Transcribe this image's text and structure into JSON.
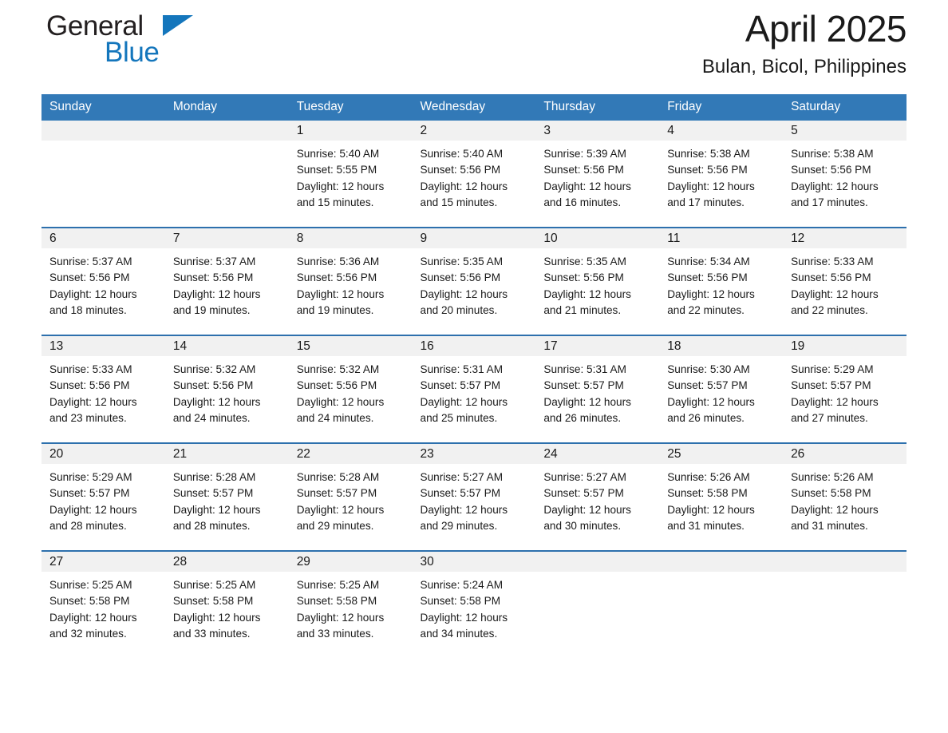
{
  "brand": {
    "line1": "General",
    "line2": "Blue",
    "triangle_icon": "brand-triangle-icon",
    "accent_color": "#1476bc"
  },
  "header": {
    "title": "April 2025",
    "subtitle": "Bulan, Bicol, Philippines"
  },
  "theme": {
    "header_bar_color": "#3279b7",
    "row_divider_color": "#2d70ad",
    "daynum_band_color": "#f1f1f1"
  },
  "weekday_headers": [
    "Sunday",
    "Monday",
    "Tuesday",
    "Wednesday",
    "Thursday",
    "Friday",
    "Saturday"
  ],
  "weeks": [
    [
      {
        "day": "",
        "sunrise": "",
        "sunset": "",
        "daylight_1": "",
        "daylight_2": ""
      },
      {
        "day": "",
        "sunrise": "",
        "sunset": "",
        "daylight_1": "",
        "daylight_2": ""
      },
      {
        "day": "1",
        "sunrise": "Sunrise: 5:40 AM",
        "sunset": "Sunset: 5:55 PM",
        "daylight_1": "Daylight: 12 hours",
        "daylight_2": "and 15 minutes."
      },
      {
        "day": "2",
        "sunrise": "Sunrise: 5:40 AM",
        "sunset": "Sunset: 5:56 PM",
        "daylight_1": "Daylight: 12 hours",
        "daylight_2": "and 15 minutes."
      },
      {
        "day": "3",
        "sunrise": "Sunrise: 5:39 AM",
        "sunset": "Sunset: 5:56 PM",
        "daylight_1": "Daylight: 12 hours",
        "daylight_2": "and 16 minutes."
      },
      {
        "day": "4",
        "sunrise": "Sunrise: 5:38 AM",
        "sunset": "Sunset: 5:56 PM",
        "daylight_1": "Daylight: 12 hours",
        "daylight_2": "and 17 minutes."
      },
      {
        "day": "5",
        "sunrise": "Sunrise: 5:38 AM",
        "sunset": "Sunset: 5:56 PM",
        "daylight_1": "Daylight: 12 hours",
        "daylight_2": "and 17 minutes."
      }
    ],
    [
      {
        "day": "6",
        "sunrise": "Sunrise: 5:37 AM",
        "sunset": "Sunset: 5:56 PM",
        "daylight_1": "Daylight: 12 hours",
        "daylight_2": "and 18 minutes."
      },
      {
        "day": "7",
        "sunrise": "Sunrise: 5:37 AM",
        "sunset": "Sunset: 5:56 PM",
        "daylight_1": "Daylight: 12 hours",
        "daylight_2": "and 19 minutes."
      },
      {
        "day": "8",
        "sunrise": "Sunrise: 5:36 AM",
        "sunset": "Sunset: 5:56 PM",
        "daylight_1": "Daylight: 12 hours",
        "daylight_2": "and 19 minutes."
      },
      {
        "day": "9",
        "sunrise": "Sunrise: 5:35 AM",
        "sunset": "Sunset: 5:56 PM",
        "daylight_1": "Daylight: 12 hours",
        "daylight_2": "and 20 minutes."
      },
      {
        "day": "10",
        "sunrise": "Sunrise: 5:35 AM",
        "sunset": "Sunset: 5:56 PM",
        "daylight_1": "Daylight: 12 hours",
        "daylight_2": "and 21 minutes."
      },
      {
        "day": "11",
        "sunrise": "Sunrise: 5:34 AM",
        "sunset": "Sunset: 5:56 PM",
        "daylight_1": "Daylight: 12 hours",
        "daylight_2": "and 22 minutes."
      },
      {
        "day": "12",
        "sunrise": "Sunrise: 5:33 AM",
        "sunset": "Sunset: 5:56 PM",
        "daylight_1": "Daylight: 12 hours",
        "daylight_2": "and 22 minutes."
      }
    ],
    [
      {
        "day": "13",
        "sunrise": "Sunrise: 5:33 AM",
        "sunset": "Sunset: 5:56 PM",
        "daylight_1": "Daylight: 12 hours",
        "daylight_2": "and 23 minutes."
      },
      {
        "day": "14",
        "sunrise": "Sunrise: 5:32 AM",
        "sunset": "Sunset: 5:56 PM",
        "daylight_1": "Daylight: 12 hours",
        "daylight_2": "and 24 minutes."
      },
      {
        "day": "15",
        "sunrise": "Sunrise: 5:32 AM",
        "sunset": "Sunset: 5:56 PM",
        "daylight_1": "Daylight: 12 hours",
        "daylight_2": "and 24 minutes."
      },
      {
        "day": "16",
        "sunrise": "Sunrise: 5:31 AM",
        "sunset": "Sunset: 5:57 PM",
        "daylight_1": "Daylight: 12 hours",
        "daylight_2": "and 25 minutes."
      },
      {
        "day": "17",
        "sunrise": "Sunrise: 5:31 AM",
        "sunset": "Sunset: 5:57 PM",
        "daylight_1": "Daylight: 12 hours",
        "daylight_2": "and 26 minutes."
      },
      {
        "day": "18",
        "sunrise": "Sunrise: 5:30 AM",
        "sunset": "Sunset: 5:57 PM",
        "daylight_1": "Daylight: 12 hours",
        "daylight_2": "and 26 minutes."
      },
      {
        "day": "19",
        "sunrise": "Sunrise: 5:29 AM",
        "sunset": "Sunset: 5:57 PM",
        "daylight_1": "Daylight: 12 hours",
        "daylight_2": "and 27 minutes."
      }
    ],
    [
      {
        "day": "20",
        "sunrise": "Sunrise: 5:29 AM",
        "sunset": "Sunset: 5:57 PM",
        "daylight_1": "Daylight: 12 hours",
        "daylight_2": "and 28 minutes."
      },
      {
        "day": "21",
        "sunrise": "Sunrise: 5:28 AM",
        "sunset": "Sunset: 5:57 PM",
        "daylight_1": "Daylight: 12 hours",
        "daylight_2": "and 28 minutes."
      },
      {
        "day": "22",
        "sunrise": "Sunrise: 5:28 AM",
        "sunset": "Sunset: 5:57 PM",
        "daylight_1": "Daylight: 12 hours",
        "daylight_2": "and 29 minutes."
      },
      {
        "day": "23",
        "sunrise": "Sunrise: 5:27 AM",
        "sunset": "Sunset: 5:57 PM",
        "daylight_1": "Daylight: 12 hours",
        "daylight_2": "and 29 minutes."
      },
      {
        "day": "24",
        "sunrise": "Sunrise: 5:27 AM",
        "sunset": "Sunset: 5:57 PM",
        "daylight_1": "Daylight: 12 hours",
        "daylight_2": "and 30 minutes."
      },
      {
        "day": "25",
        "sunrise": "Sunrise: 5:26 AM",
        "sunset": "Sunset: 5:58 PM",
        "daylight_1": "Daylight: 12 hours",
        "daylight_2": "and 31 minutes."
      },
      {
        "day": "26",
        "sunrise": "Sunrise: 5:26 AM",
        "sunset": "Sunset: 5:58 PM",
        "daylight_1": "Daylight: 12 hours",
        "daylight_2": "and 31 minutes."
      }
    ],
    [
      {
        "day": "27",
        "sunrise": "Sunrise: 5:25 AM",
        "sunset": "Sunset: 5:58 PM",
        "daylight_1": "Daylight: 12 hours",
        "daylight_2": "and 32 minutes."
      },
      {
        "day": "28",
        "sunrise": "Sunrise: 5:25 AM",
        "sunset": "Sunset: 5:58 PM",
        "daylight_1": "Daylight: 12 hours",
        "daylight_2": "and 33 minutes."
      },
      {
        "day": "29",
        "sunrise": "Sunrise: 5:25 AM",
        "sunset": "Sunset: 5:58 PM",
        "daylight_1": "Daylight: 12 hours",
        "daylight_2": "and 33 minutes."
      },
      {
        "day": "30",
        "sunrise": "Sunrise: 5:24 AM",
        "sunset": "Sunset: 5:58 PM",
        "daylight_1": "Daylight: 12 hours",
        "daylight_2": "and 34 minutes."
      },
      {
        "day": "",
        "sunrise": "",
        "sunset": "",
        "daylight_1": "",
        "daylight_2": ""
      },
      {
        "day": "",
        "sunrise": "",
        "sunset": "",
        "daylight_1": "",
        "daylight_2": ""
      },
      {
        "day": "",
        "sunrise": "",
        "sunset": "",
        "daylight_1": "",
        "daylight_2": ""
      }
    ]
  ]
}
